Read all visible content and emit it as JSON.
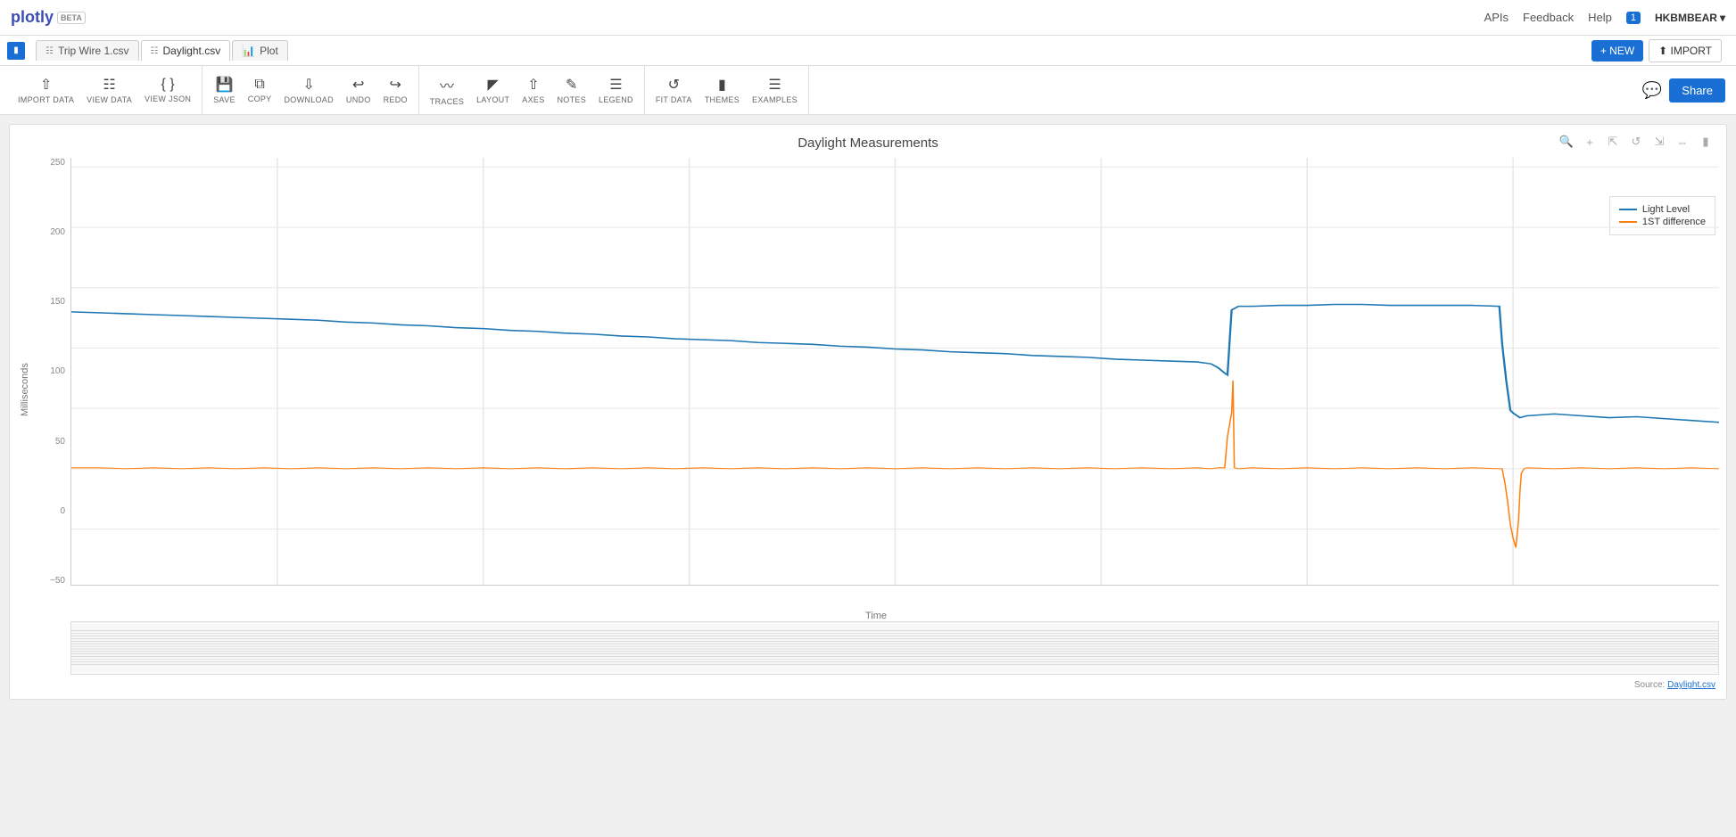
{
  "nav": {
    "logo": "plotly",
    "beta": "BETA",
    "links": [
      "APIs",
      "Feedback",
      "Help"
    ],
    "notifications": "1",
    "user": "HKBMBEAR",
    "user_arrow": "▾"
  },
  "tabs": [
    {
      "id": "files",
      "icon": "grid",
      "label": ""
    },
    {
      "id": "trip-wire",
      "icon": "grid",
      "label": "Trip Wire 1.csv"
    },
    {
      "id": "daylight",
      "icon": "grid",
      "label": "Daylight.csv",
      "active": true
    },
    {
      "id": "plot",
      "icon": "chart",
      "label": "Plot"
    }
  ],
  "toolbar": {
    "import_data": "IMPORT DATA",
    "view_data": "VIEW DATA",
    "view_json": "VIEW JSON",
    "save": "SAVE",
    "copy": "COPY",
    "download": "DOWNLOAD",
    "undo": "UNDO",
    "redo": "REDO",
    "traces": "TRACES",
    "layout": "LAYOUT",
    "axes": "AXES",
    "notes": "NOTES",
    "legend": "LEGEND",
    "fit_data": "FIT DATA",
    "themes": "THEMES",
    "examples": "EXAMPLES",
    "new_label": "+ NEW",
    "import_label": "⬆ IMPORT",
    "share_label": "Share"
  },
  "chart": {
    "title": "Daylight Measurements",
    "y_label": "Milliseconds",
    "x_label": "Time",
    "source_text": "Source: Daylight.csv",
    "y_ticks": [
      "250",
      "200",
      "150",
      "100",
      "50",
      "0",
      "-50"
    ],
    "legend": [
      {
        "label": "Light Level",
        "color": "#1f77b4"
      },
      {
        "label": "1ST difference",
        "color": "#ff7f0e"
      }
    ]
  }
}
